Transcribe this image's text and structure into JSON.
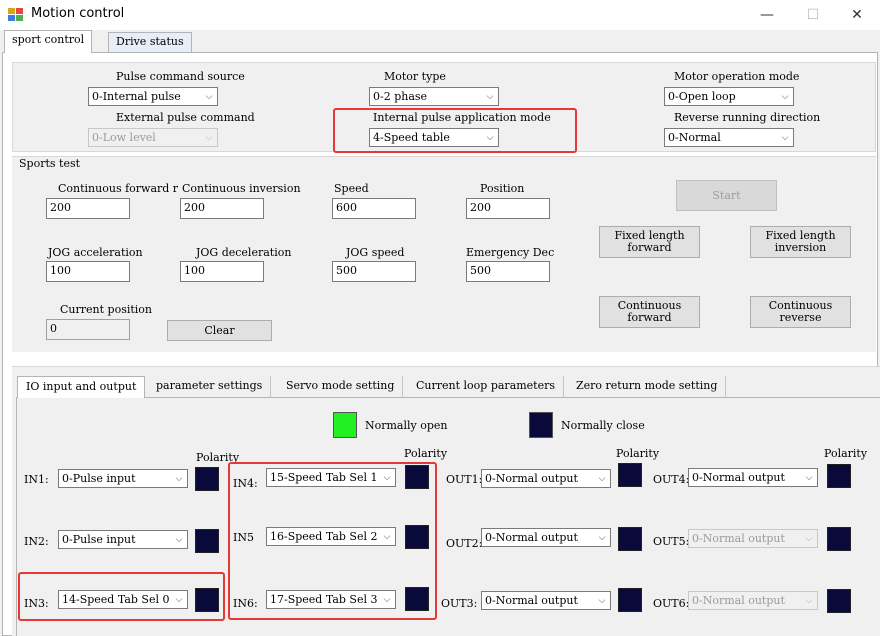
{
  "window": {
    "title": "Motion control",
    "minimize_glyph": "—",
    "maximize_glyph": "☐",
    "close_glyph": "✕"
  },
  "tabs": [
    "sport control",
    "Drive status"
  ],
  "config": {
    "pulse_command_source": {
      "label": "Pulse command source",
      "value": "0-Internal pulse"
    },
    "motor_type": {
      "label": "Motor type",
      "value": "0-2 phase"
    },
    "motor_operation_mode": {
      "label": "Motor operation mode",
      "value": "0-Open loop"
    },
    "external_pulse_command": {
      "label": "External pulse command",
      "value": "0-Low level"
    },
    "internal_pulse_mode": {
      "label": "Internal pulse application mode",
      "value": "4-Speed table"
    },
    "reverse_direction": {
      "label": "Reverse running direction",
      "value": "0-Normal"
    }
  },
  "sports_test": {
    "group_title": "Sports test",
    "continuous_forward": {
      "label": "Continuous forward r",
      "value": "200"
    },
    "continuous_inversion": {
      "label": "Continuous inversion",
      "value": "200"
    },
    "speed": {
      "label": "Speed",
      "value": "600"
    },
    "position": {
      "label": "Position",
      "value": "200"
    },
    "jog_accel": {
      "label": "JOG acceleration",
      "value": "100"
    },
    "jog_decel": {
      "label": "JOG deceleration",
      "value": "100"
    },
    "jog_speed": {
      "label": "JOG speed",
      "value": "500"
    },
    "emergency_dec": {
      "label": "Emergency Dec",
      "value": "500"
    },
    "current_position": {
      "label": "Current position",
      "value": "0"
    },
    "clear_label": "Clear",
    "start_label": "Start",
    "fixed_forward_label": "Fixed length forward",
    "fixed_inversion_label": "Fixed length inversion",
    "cont_forward_label": "Continuous forward",
    "cont_reverse_label": "Continuous reverse"
  },
  "io_tabs": [
    "IO input and output",
    "parameter settings",
    "Servo mode setting",
    "Current loop parameters",
    "Zero return mode setting"
  ],
  "io": {
    "legend_open": "Normally open",
    "legend_close": "Normally close",
    "polarity": "Polarity",
    "inputs": [
      {
        "name": "IN1:",
        "value": "0-Pulse input"
      },
      {
        "name": "IN2:",
        "value": "0-Pulse input"
      },
      {
        "name": "IN3:",
        "value": "14-Speed Tab Sel 0"
      },
      {
        "name": "IN4:",
        "value": "15-Speed Tab Sel 1"
      },
      {
        "name": "IN5",
        "value": "16-Speed Tab Sel 2"
      },
      {
        "name": "IN6:",
        "value": "17-Speed Tab Sel 3"
      }
    ],
    "outputs": [
      {
        "name": "OUT1:",
        "value": "0-Normal output"
      },
      {
        "name": "OUT2:",
        "value": "0-Normal output"
      },
      {
        "name": "OUT3:",
        "value": "0-Normal output"
      },
      {
        "name": "OUT4:",
        "value": "0-Normal output"
      },
      {
        "name": "OUT5:",
        "value": "0-Normal output"
      },
      {
        "name": "OUT6:",
        "value": "0-Normal output"
      }
    ]
  },
  "colors": {
    "normally_open": "#22f022",
    "normally_close": "#0a0a3a",
    "highlight": "#e53935"
  }
}
